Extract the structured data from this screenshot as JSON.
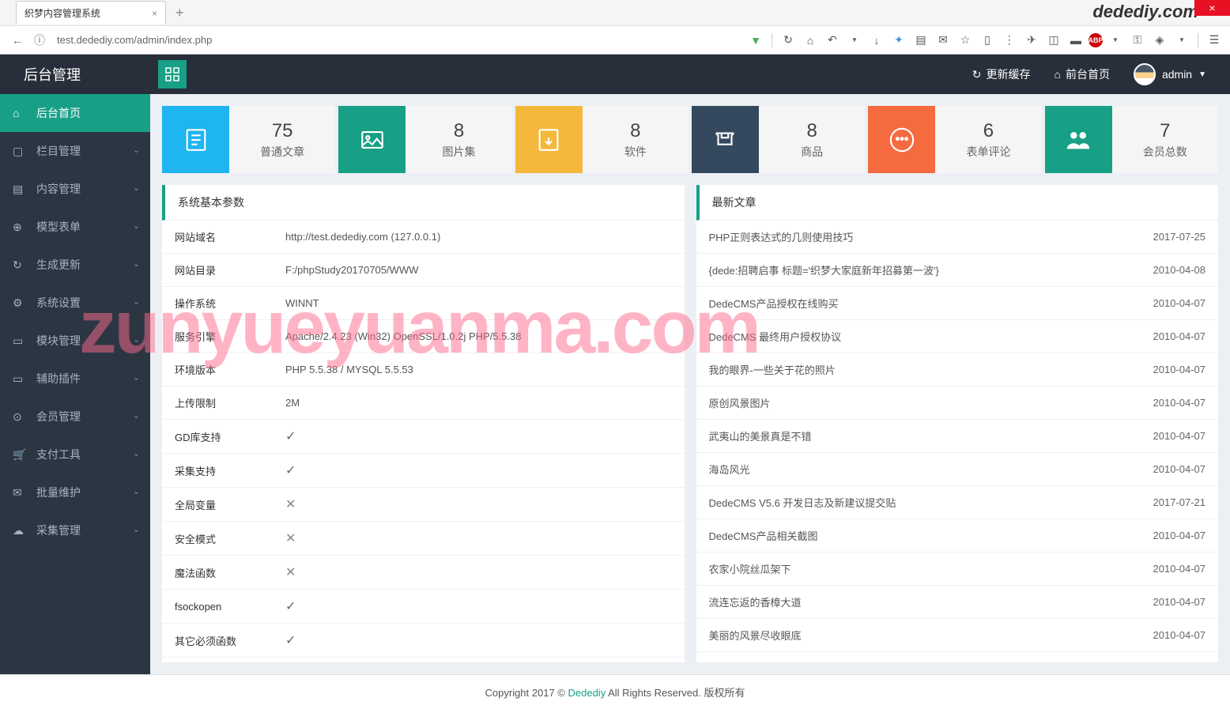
{
  "browser": {
    "tab_title": "织梦内容管理系统",
    "url": "test.dedediy.com/admin/index.php"
  },
  "watermark_logo": "dedediy.com",
  "watermark_big": "zunyueyuanma.com",
  "topbar": {
    "brand": "后台管理",
    "refresh": "更新缓存",
    "frontend": "前台首页",
    "user": "admin"
  },
  "sidebar": [
    {
      "label": "后台首页",
      "active": true,
      "chev": false
    },
    {
      "label": "栏目管理",
      "active": false,
      "chev": true
    },
    {
      "label": "内容管理",
      "active": false,
      "chev": true
    },
    {
      "label": "模型表单",
      "active": false,
      "chev": true
    },
    {
      "label": "生成更新",
      "active": false,
      "chev": true
    },
    {
      "label": "系统设置",
      "active": false,
      "chev": true
    },
    {
      "label": "模块管理",
      "active": false,
      "chev": true
    },
    {
      "label": "辅助插件",
      "active": false,
      "chev": true
    },
    {
      "label": "会员管理",
      "active": false,
      "chev": true
    },
    {
      "label": "支付工具",
      "active": false,
      "chev": true
    },
    {
      "label": "批量维护",
      "active": false,
      "chev": true
    },
    {
      "label": "采集管理",
      "active": false,
      "chev": true
    }
  ],
  "stats": [
    {
      "num": "75",
      "label": "普通文章"
    },
    {
      "num": "8",
      "label": "图片集"
    },
    {
      "num": "8",
      "label": "软件"
    },
    {
      "num": "8",
      "label": "商品"
    },
    {
      "num": "6",
      "label": "表单评论"
    },
    {
      "num": "7",
      "label": "会员总数"
    }
  ],
  "params": {
    "title": "系统基本参数",
    "rows": [
      {
        "k": "网站域名",
        "v": "http://test.dedediy.com (127.0.0.1)"
      },
      {
        "k": "网站目录",
        "v": "F:/phpStudy20170705/WWW"
      },
      {
        "k": "操作系统",
        "v": "WINNT"
      },
      {
        "k": "服务引擎",
        "v": "Apache/2.4.23 (Win32) OpenSSL/1.0.2j PHP/5.5.38"
      },
      {
        "k": "环境版本",
        "v": "PHP 5.5.38 / MYSQL 5.5.53"
      },
      {
        "k": "上传限制",
        "v": "2M"
      },
      {
        "k": "GD库支持",
        "v": "✓"
      },
      {
        "k": "采集支持",
        "v": "✓"
      },
      {
        "k": "全局变量",
        "v": "✕"
      },
      {
        "k": "安全模式",
        "v": "✕"
      },
      {
        "k": "魔法函数",
        "v": "✕"
      },
      {
        "k": "fsockopen",
        "v": "✓"
      },
      {
        "k": "其它必须函数",
        "v": "✓"
      }
    ]
  },
  "articles": {
    "title": "最新文章",
    "rows": [
      {
        "t": "PHP正则表达式的几则使用技巧",
        "d": "2017-07-25"
      },
      {
        "t": "{dede:招聘启事 标题='织梦大家庭新年招募第一波'}",
        "d": "2010-04-08"
      },
      {
        "t": "DedeCMS产品授权在线购买",
        "d": "2010-04-07"
      },
      {
        "t": "DedeCMS 最终用户授权协议",
        "d": "2010-04-07"
      },
      {
        "t": "我的眼界-一些关于花的照片",
        "d": "2010-04-07"
      },
      {
        "t": "原创风景图片",
        "d": "2010-04-07"
      },
      {
        "t": "武夷山的美景真是不错",
        "d": "2010-04-07"
      },
      {
        "t": "海岛风光",
        "d": "2010-04-07"
      },
      {
        "t": "DedeCMS V5.6 开发日志及新建议提交贴",
        "d": "2017-07-21"
      },
      {
        "t": "DedeCMS产品相关截图",
        "d": "2010-04-07"
      },
      {
        "t": "农家小院丝瓜架下",
        "d": "2010-04-07"
      },
      {
        "t": "流连忘返的香樟大道",
        "d": "2010-04-07"
      },
      {
        "t": "美丽的风景尽收眼底",
        "d": "2010-04-07"
      }
    ]
  },
  "footer": {
    "copy": "Copyright 2017 © ",
    "brand": "Dedediy",
    "rights": " All Rights Reserved. 版权所有"
  }
}
